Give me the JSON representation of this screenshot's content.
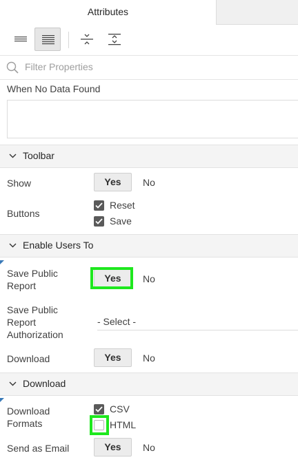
{
  "tabs": {
    "active": "Attributes"
  },
  "filter": {
    "placeholder": "Filter Properties"
  },
  "fields": {
    "no_data_found_label": "When No Data Found",
    "show_label": "Show",
    "buttons_label": "Buttons",
    "save_public_report_label": "Save Public\nReport",
    "save_public_auth_label": "Save Public\nReport\nAuthorization",
    "download_label": "Download",
    "download_formats_label": "Download\nFormats",
    "send_email_label": "Send as Email"
  },
  "sections": {
    "toolbar": "Toolbar",
    "enable_users": "Enable Users To",
    "download": "Download"
  },
  "toggles": {
    "yes": "Yes",
    "no": "No"
  },
  "checkboxes": {
    "reset": {
      "label": "Reset",
      "checked": true
    },
    "save": {
      "label": "Save",
      "checked": true
    },
    "csv": {
      "label": "CSV",
      "checked": true
    },
    "html": {
      "label": "HTML",
      "checked": false
    }
  },
  "select": {
    "value": "- Select -"
  },
  "colors": {
    "highlight": "#1ee81e",
    "section_bg": "#f4f4f4",
    "toggle_on_bg": "#ececec"
  }
}
